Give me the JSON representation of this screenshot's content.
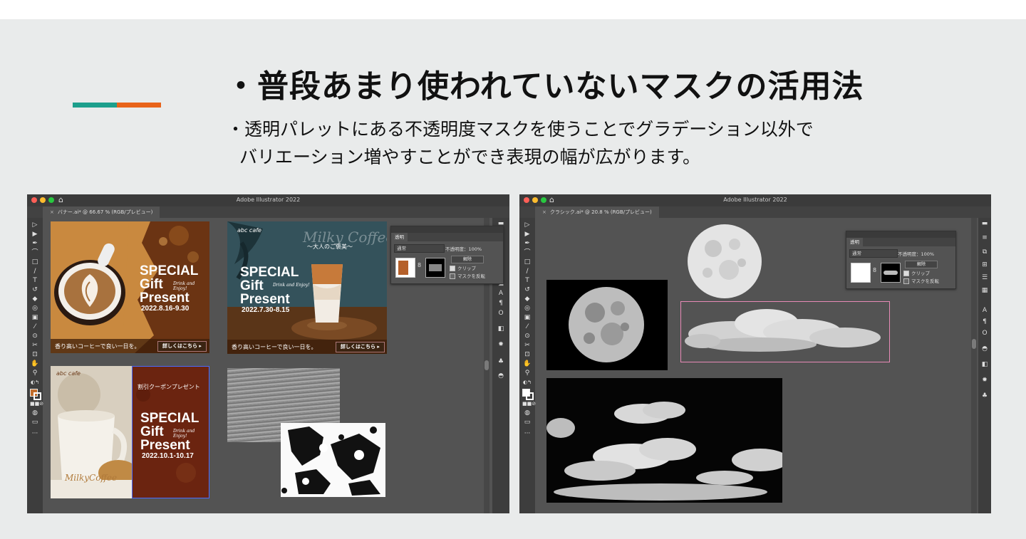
{
  "colors": {
    "accent_teal": "#1d9f8c",
    "accent_orange": "#e8631a",
    "slide_bg": "#e9ebeb",
    "ui_dark": "#535353"
  },
  "slide": {
    "title": "・普段あまり使われていないマスクの活用法",
    "subtitle_line1": "・透明パレットにある不透明度マスクを使うことでグラデーション以外で",
    "subtitle_line2": "バリエーション増やすことができ表現の幅が広がります。"
  },
  "left_window": {
    "app_title": "Adobe Illustrator 2022",
    "tab_label": "バナー.ai* @ 66.67 % (RGB/プレビュー)",
    "banner1": {
      "special": "SPECIAL",
      "gift": "Gift",
      "present": "Present",
      "date": "2022.8.16-9.30",
      "script": "Drink and Enjoy!",
      "caption": "香り高いコーヒーで良い一日を。",
      "button": "詳しくはこちら ▸"
    },
    "banner2": {
      "logo": "abc cafe",
      "brand": "Milky Coffee",
      "tagline": "〜大人のご褒美〜",
      "special": "SPECIAL",
      "gift": "Gift",
      "present": "Present",
      "date": "2022.7.30-8.15",
      "script": "Drink and Enjoy!",
      "caption": "香り高いコーヒーで良い一日を。",
      "button": "詳しくはこちら ▸"
    },
    "banner3": {
      "logo": "abc cafe",
      "cup_brand": "MilkyCoffee",
      "coupon": "割引クーポンプレゼント",
      "special": "SPECIAL",
      "gift": "Gift",
      "present": "Present",
      "date": "2022.10.1-10.17",
      "script": "Drink and Enjoy!"
    },
    "panel": {
      "tab": "透明",
      "blend_mode": "通常",
      "opacity": "不透明度：100%",
      "release": "解除",
      "clip": "クリップ",
      "invert": "マスクを反転",
      "link_icon": "8"
    }
  },
  "right_window": {
    "app_title": "Adobe Illustrator 2022",
    "tab_label": "クラシック.ai* @ 20.8 % (RGB/プレビュー)",
    "panel": {
      "tab": "透明",
      "blend_mode": "通常",
      "opacity": "不透明度：100%",
      "release": "解除",
      "clip": "クリップ",
      "invert": "マスクを反転",
      "link_icon": "8"
    }
  }
}
